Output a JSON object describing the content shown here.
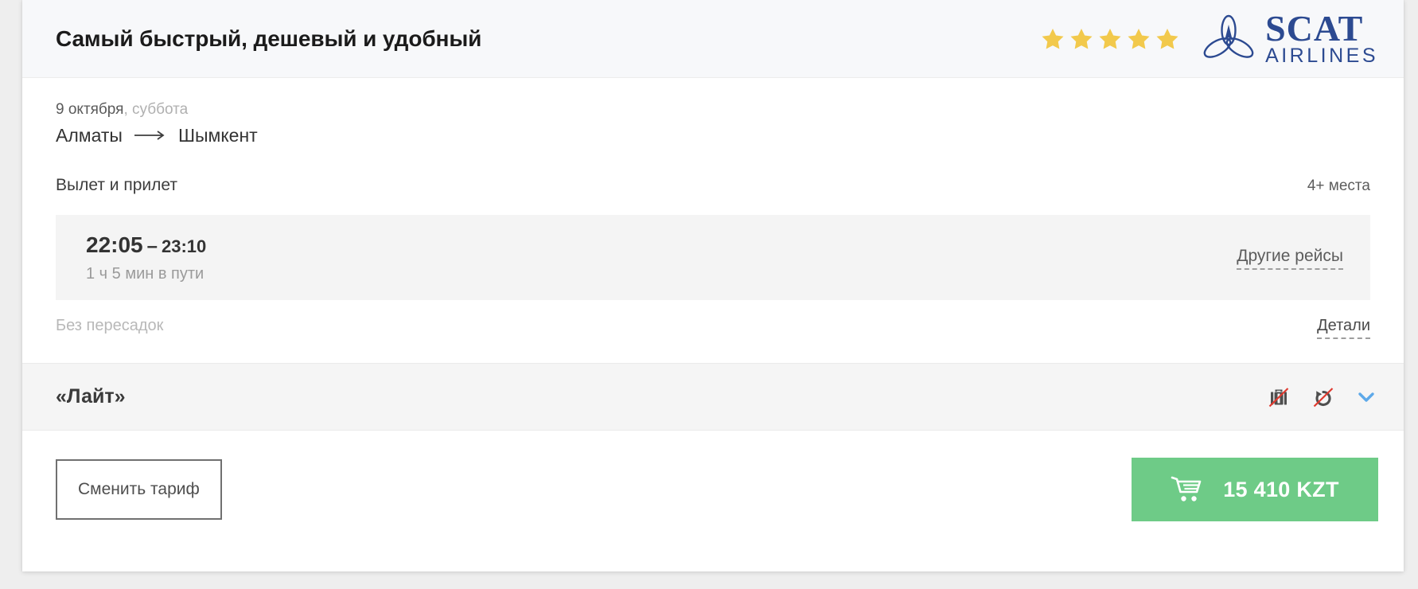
{
  "card": {
    "header": {
      "title": "Самый быстрый, дешевый и удобный",
      "rating_stars": 5,
      "star_color": "#F2C94C",
      "airline": {
        "name": "SCAT",
        "subtitle": "AIRLINES",
        "logo_color": "#2C4A91",
        "emblem_icon": "trefoil-propeller-icon"
      }
    },
    "trip": {
      "date": "9 октября",
      "weekday": ", суббота",
      "origin": "Алматы",
      "arrow_icon": "long-arrow-right-icon",
      "destination": "Шымкент"
    },
    "segment_section": {
      "title": "Вылет и прилет",
      "seats_left": "4+ места"
    },
    "flight": {
      "departure_time": "22:05",
      "dash": "–",
      "arrival_time": "23:10",
      "duration": "1 ч 5 мин в пути",
      "other_flights_label": "Другие рейсы",
      "stops": "Без пересадок",
      "details_label": "Детали"
    },
    "fare": {
      "name": "«Лайт»",
      "icons": [
        {
          "name": "no-baggage-icon",
          "label": "Без багажа",
          "struck": true
        },
        {
          "name": "non-refundable-icon",
          "label": "Невозвратный",
          "struck": true
        },
        {
          "name": "chevron-down-icon",
          "label": "Развернуть",
          "struck": false
        }
      ],
      "strike_color": "#E03A2F",
      "icon_color": "#4F4F4F",
      "chevron_color": "#5DA9E9"
    },
    "footer": {
      "change_fare_label": "Сменить тариф",
      "buy_button": {
        "cart_icon": "shopping-cart-icon",
        "price": "15 410 KZT",
        "color": "#6ECB87"
      }
    }
  }
}
